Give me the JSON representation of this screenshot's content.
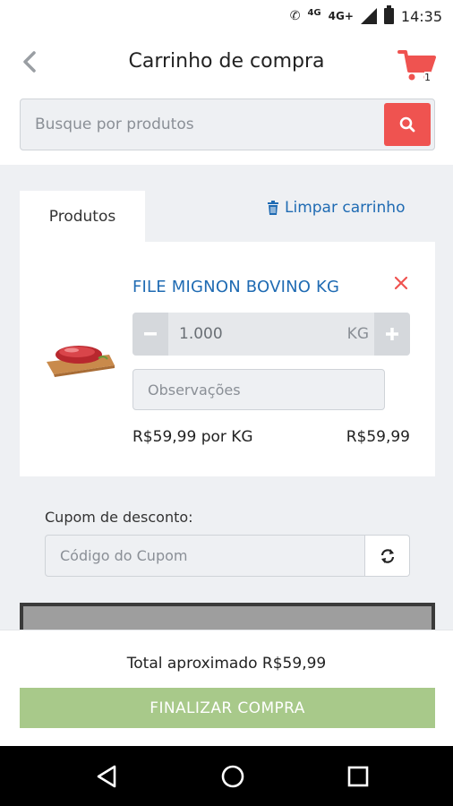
{
  "status_bar": {
    "network_small": "4G",
    "network": "4G+",
    "time": "14:35"
  },
  "header": {
    "title": "Carrinho de compra",
    "cart_count": "1"
  },
  "search": {
    "placeholder": "Busque por produtos"
  },
  "tabs": {
    "products_label": "Produtos"
  },
  "clear_cart_label": "Limpar carrinho",
  "cart_items": [
    {
      "name": "FILE MIGNON BOVINO KG",
      "quantity": "1.000",
      "unit": "KG",
      "notes_placeholder": "Observações",
      "unit_price": "R$59,99 por KG",
      "line_total": "R$59,99"
    }
  ],
  "coupon": {
    "label": "Cupom de desconto:",
    "placeholder": "Código do Cupom"
  },
  "footer": {
    "total_text": "Total aproximado R$59,99",
    "checkout_label": "FINALIZAR COMPRA"
  },
  "colors": {
    "accent_red": "#ef5350",
    "link_blue": "#1f6bb3",
    "checkout_green": "#a8c98a"
  }
}
